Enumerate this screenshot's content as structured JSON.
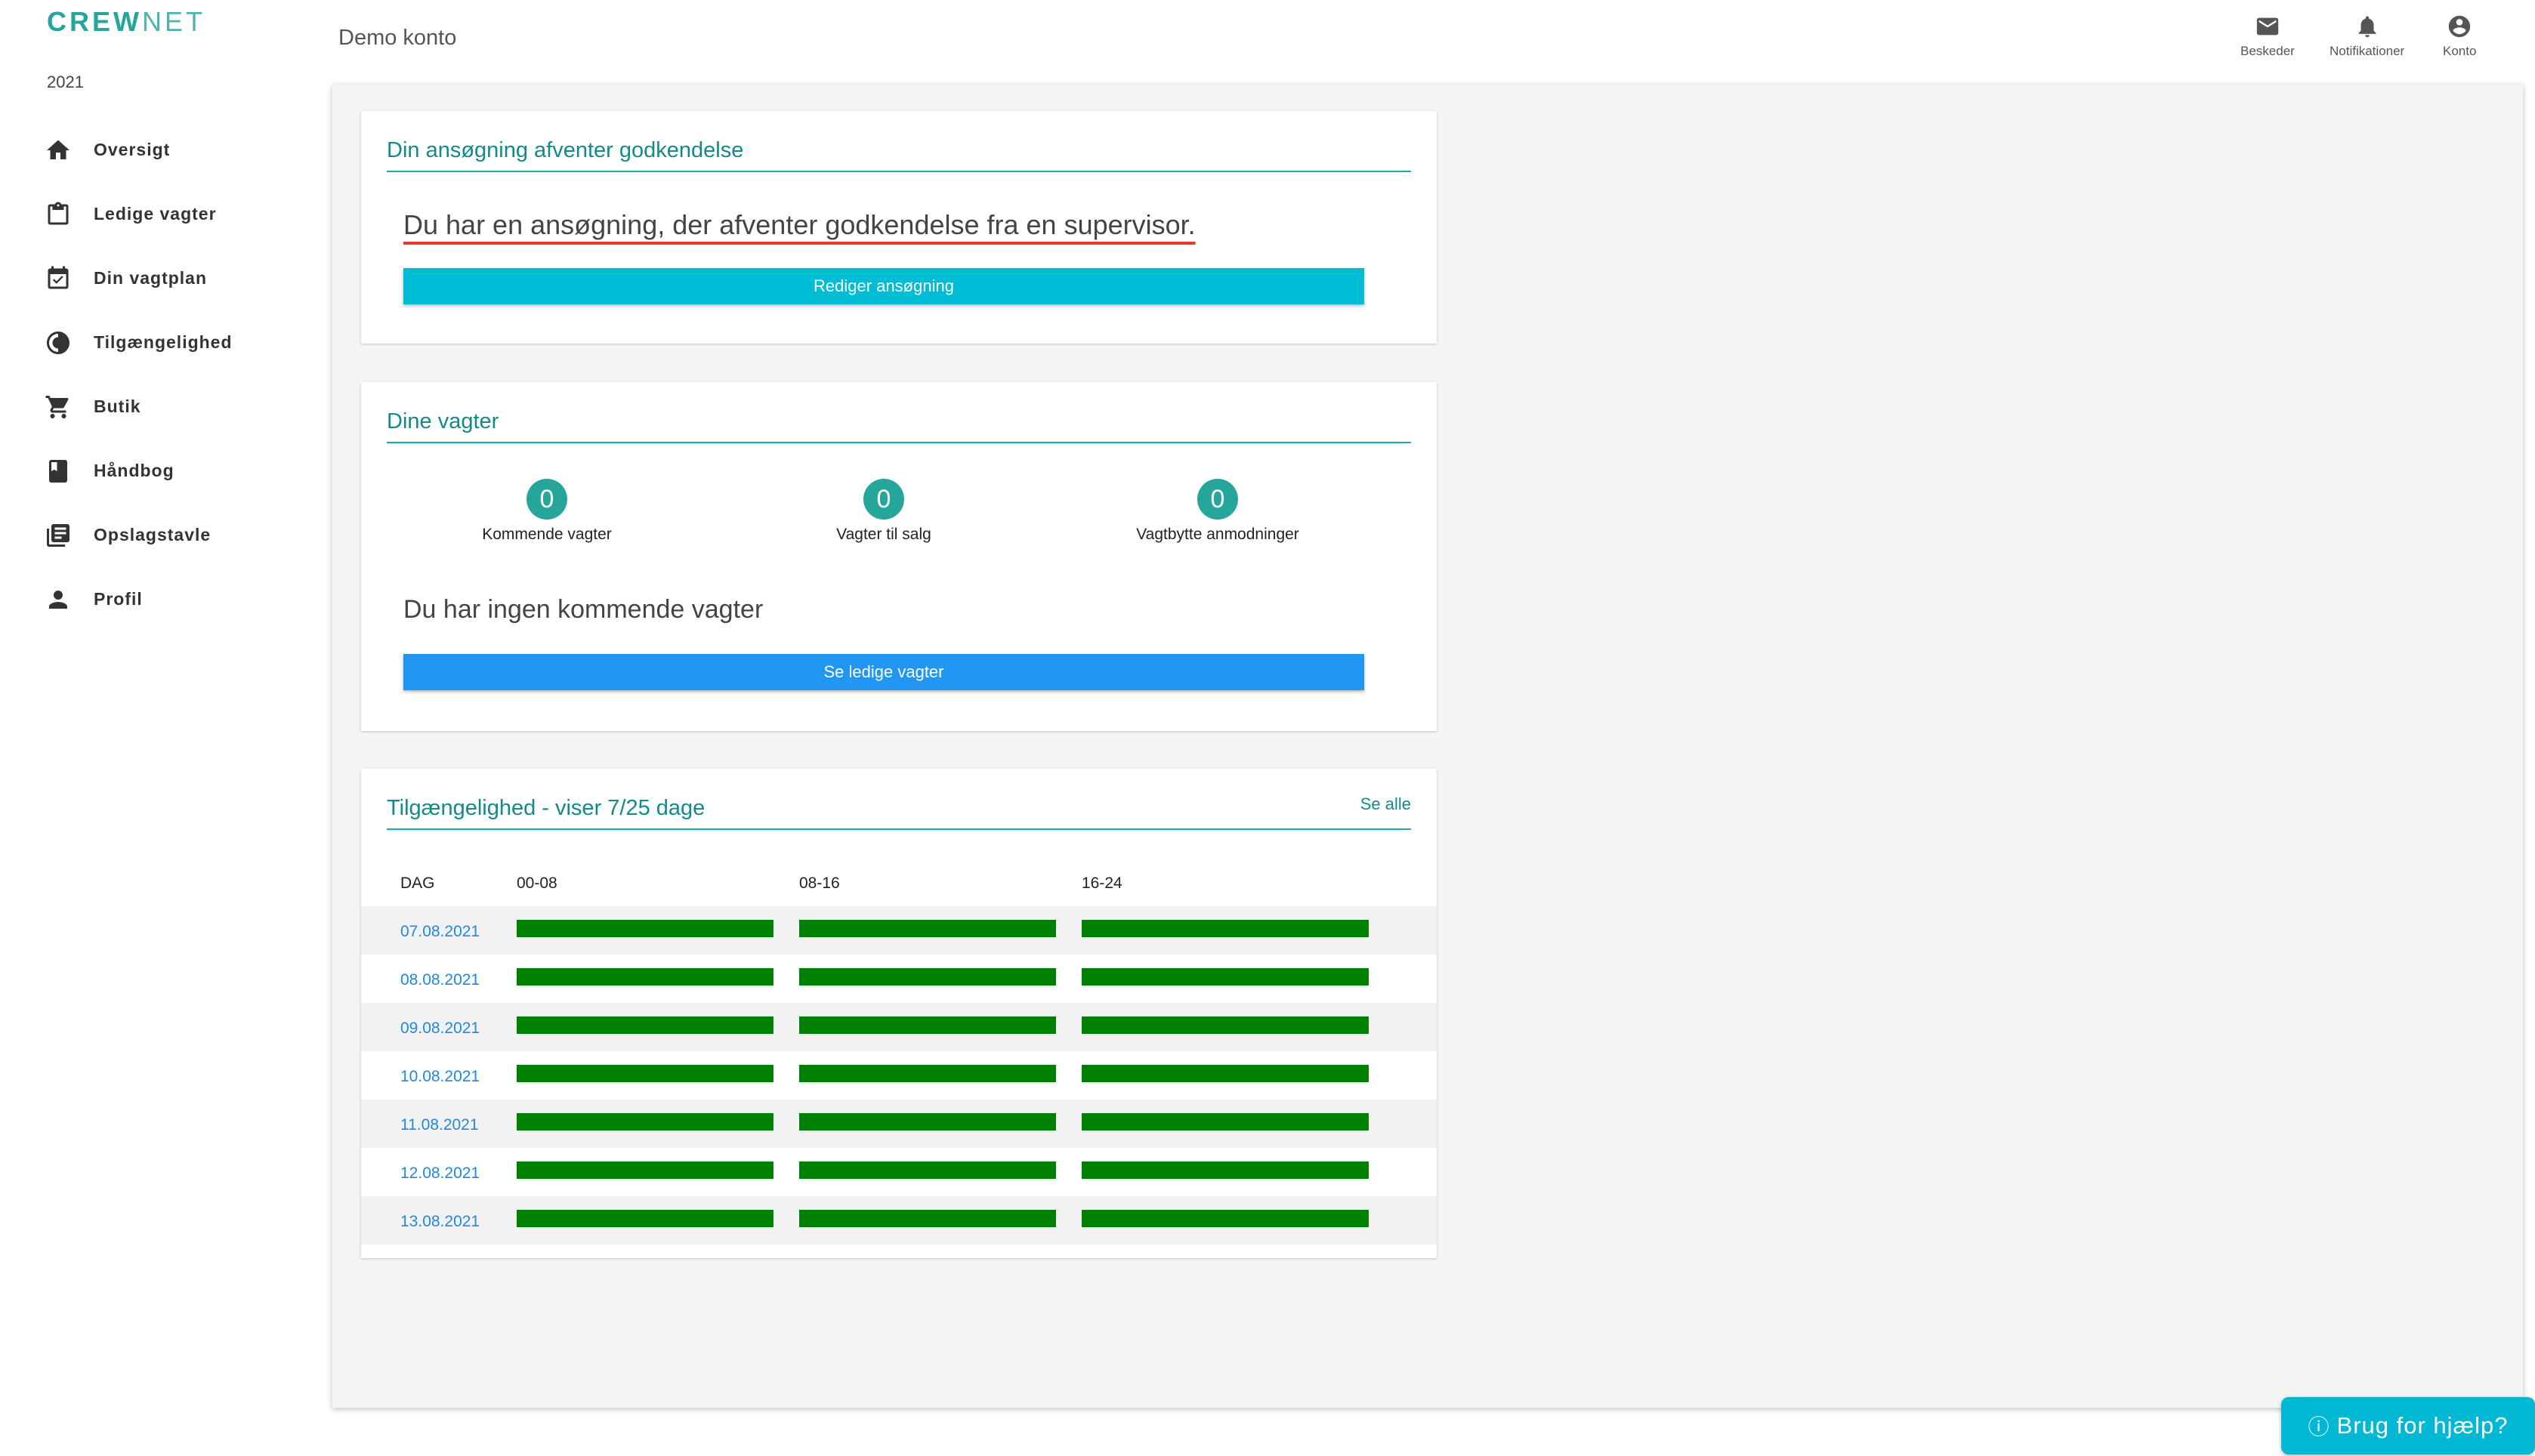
{
  "app": {
    "logo_a": "CREW",
    "logo_b": "NET",
    "year": "2021"
  },
  "sidebar": {
    "items": [
      {
        "label": "Oversigt",
        "icon": "home-icon"
      },
      {
        "label": "Ledige vagter",
        "icon": "clipboard-icon"
      },
      {
        "label": "Din vagtplan",
        "icon": "calendar-check-icon"
      },
      {
        "label": "Tilgængelighed",
        "icon": "contrast-icon"
      },
      {
        "label": "Butik",
        "icon": "cart-icon"
      },
      {
        "label": "Håndbog",
        "icon": "book-icon"
      },
      {
        "label": "Opslagstavle",
        "icon": "board-icon"
      },
      {
        "label": "Profil",
        "icon": "person-icon"
      }
    ]
  },
  "header": {
    "account_name": "Demo konto",
    "messages_label": "Beskeder",
    "notifications_label": "Notifikationer",
    "account_label": "Konto"
  },
  "application_card": {
    "title": "Din ansøgning afventer godkendelse",
    "text": "Du har en ansøgning, der afventer godkendelse fra en supervisor.",
    "button": "Rediger ansøgning"
  },
  "shifts_card": {
    "title": "Dine vagter",
    "stats": [
      {
        "count": "0",
        "label": "Kommende vagter"
      },
      {
        "count": "0",
        "label": "Vagter til salg"
      },
      {
        "count": "0",
        "label": "Vagtbytte anmodninger"
      }
    ],
    "empty_text": "Du har ingen kommende vagter",
    "button": "Se ledige vagter"
  },
  "availability_card": {
    "title": "Tilgængelighed - viser 7/25 dage",
    "see_all": "Se alle",
    "columns": [
      "DAG",
      "00-08",
      "08-16",
      "16-24"
    ],
    "rows": [
      {
        "date": "07.08.2021",
        "slots": [
          1,
          1,
          1
        ]
      },
      {
        "date": "08.08.2021",
        "slots": [
          1,
          1,
          1
        ]
      },
      {
        "date": "09.08.2021",
        "slots": [
          1,
          1,
          1
        ]
      },
      {
        "date": "10.08.2021",
        "slots": [
          1,
          1,
          1
        ]
      },
      {
        "date": "11.08.2021",
        "slots": [
          1,
          1,
          1
        ]
      },
      {
        "date": "12.08.2021",
        "slots": [
          1,
          1,
          1
        ]
      },
      {
        "date": "13.08.2021",
        "slots": [
          1,
          1,
          1
        ]
      }
    ],
    "available_color": "#008000"
  },
  "help": {
    "label": "Brug for hjælp?"
  },
  "colors": {
    "accent": "#26a69a",
    "edit_button": "#00bcd4",
    "primary_button": "#2196f3",
    "link": "#1e88e5",
    "warning_underline": "#e53935"
  }
}
